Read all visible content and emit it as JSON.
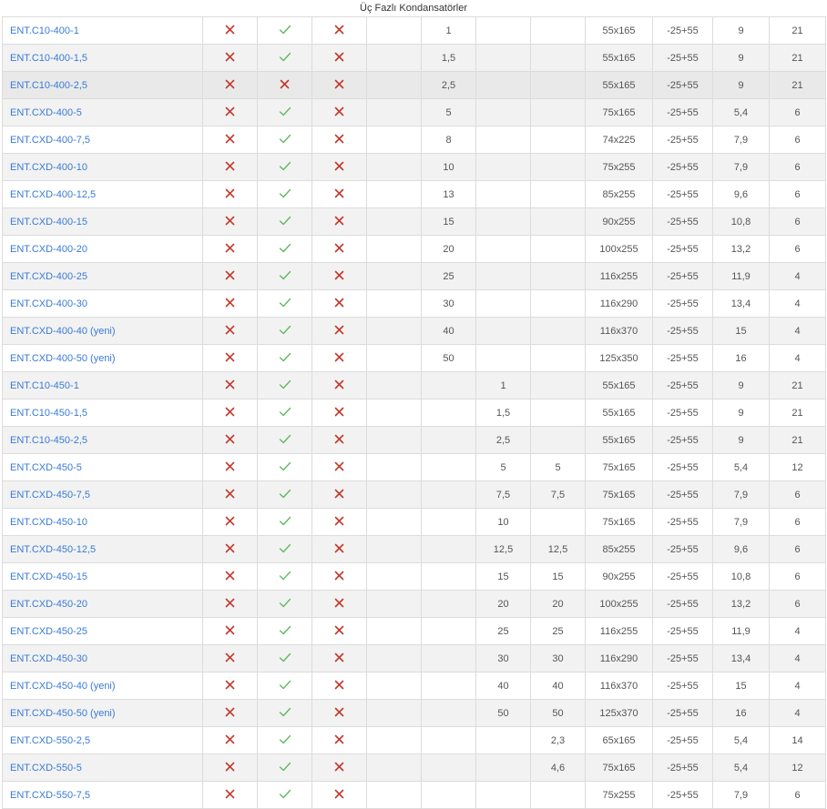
{
  "table": {
    "caption": "Üç Fazlı Kondansatörler",
    "rows": [
      {
        "name": "ENT.C10-400-1",
        "m1": "x",
        "m2": "check",
        "m3": "x",
        "c4": "",
        "c5": "1",
        "c6": "",
        "c7": "",
        "dim": "55x165",
        "temp": "-25+55",
        "c10": "9",
        "c11": "21"
      },
      {
        "name": "ENT.C10-400-1,5",
        "m1": "x",
        "m2": "check",
        "m3": "x",
        "c4": "",
        "c5": "1,5",
        "c6": "",
        "c7": "",
        "dim": "55x165",
        "temp": "-25+55",
        "c10": "9",
        "c11": "21"
      },
      {
        "name": "ENT.C10-400-2,5",
        "m1": "x",
        "m2": "x",
        "m3": "x",
        "c4": "",
        "c5": "2,5",
        "c6": "",
        "c7": "",
        "dim": "55x165",
        "temp": "-25+55",
        "c10": "9",
        "c11": "21"
      },
      {
        "name": "ENT.CXD-400-5",
        "m1": "x",
        "m2": "check",
        "m3": "x",
        "c4": "",
        "c5": "5",
        "c6": "",
        "c7": "",
        "dim": "75x165",
        "temp": "-25+55",
        "c10": "5,4",
        "c11": "6"
      },
      {
        "name": "ENT.CXD-400-7,5",
        "m1": "x",
        "m2": "check",
        "m3": "x",
        "c4": "",
        "c5": "8",
        "c6": "",
        "c7": "",
        "dim": "74x225",
        "temp": "-25+55",
        "c10": "7,9",
        "c11": "6"
      },
      {
        "name": "ENT.CXD-400-10",
        "m1": "x",
        "m2": "check",
        "m3": "x",
        "c4": "",
        "c5": "10",
        "c6": "",
        "c7": "",
        "dim": "75x255",
        "temp": "-25+55",
        "c10": "7,9",
        "c11": "6"
      },
      {
        "name": "ENT.CXD-400-12,5",
        "m1": "x",
        "m2": "check",
        "m3": "x",
        "c4": "",
        "c5": "13",
        "c6": "",
        "c7": "",
        "dim": "85x255",
        "temp": "-25+55",
        "c10": "9,6",
        "c11": "6"
      },
      {
        "name": "ENT.CXD-400-15",
        "m1": "x",
        "m2": "check",
        "m3": "x",
        "c4": "",
        "c5": "15",
        "c6": "",
        "c7": "",
        "dim": "90x255",
        "temp": "-25+55",
        "c10": "10,8",
        "c11": "6"
      },
      {
        "name": "ENT.CXD-400-20",
        "m1": "x",
        "m2": "check",
        "m3": "x",
        "c4": "",
        "c5": "20",
        "c6": "",
        "c7": "",
        "dim": "100x255",
        "temp": "-25+55",
        "c10": "13,2",
        "c11": "6"
      },
      {
        "name": "ENT.CXD-400-25",
        "m1": "x",
        "m2": "check",
        "m3": "x",
        "c4": "",
        "c5": "25",
        "c6": "",
        "c7": "",
        "dim": "116x255",
        "temp": "-25+55",
        "c10": "11,9",
        "c11": "4"
      },
      {
        "name": "ENT.CXD-400-30",
        "m1": "x",
        "m2": "check",
        "m3": "x",
        "c4": "",
        "c5": "30",
        "c6": "",
        "c7": "",
        "dim": "116x290",
        "temp": "-25+55",
        "c10": "13,4",
        "c11": "4"
      },
      {
        "name": "ENT.CXD-400-40 (yeni)",
        "m1": "x",
        "m2": "check",
        "m3": "x",
        "c4": "",
        "c5": "40",
        "c6": "",
        "c7": "",
        "dim": "116x370",
        "temp": "-25+55",
        "c10": "15",
        "c11": "4"
      },
      {
        "name": "ENT.CXD-400-50 (yeni)",
        "m1": "x",
        "m2": "check",
        "m3": "x",
        "c4": "",
        "c5": "50",
        "c6": "",
        "c7": "",
        "dim": "125x350",
        "temp": "-25+55",
        "c10": "16",
        "c11": "4"
      },
      {
        "name": "ENT.C10-450-1",
        "m1": "x",
        "m2": "check",
        "m3": "x",
        "c4": "",
        "c5": "",
        "c6": "1",
        "c7": "",
        "dim": "55x165",
        "temp": "-25+55",
        "c10": "9",
        "c11": "21"
      },
      {
        "name": "ENT.C10-450-1,5",
        "m1": "x",
        "m2": "check",
        "m3": "x",
        "c4": "",
        "c5": "",
        "c6": "1,5",
        "c7": "",
        "dim": "55x165",
        "temp": "-25+55",
        "c10": "9",
        "c11": "21"
      },
      {
        "name": "ENT.C10-450-2,5",
        "m1": "x",
        "m2": "check",
        "m3": "x",
        "c4": "",
        "c5": "",
        "c6": "2,5",
        "c7": "",
        "dim": "55x165",
        "temp": "-25+55",
        "c10": "9",
        "c11": "21"
      },
      {
        "name": "ENT.CXD-450-5",
        "m1": "x",
        "m2": "check",
        "m3": "x",
        "c4": "",
        "c5": "",
        "c6": "5",
        "c7": "5",
        "dim": "75x165",
        "temp": "-25+55",
        "c10": "5,4",
        "c11": "12"
      },
      {
        "name": "ENT.CXD-450-7,5",
        "m1": "x",
        "m2": "check",
        "m3": "x",
        "c4": "",
        "c5": "",
        "c6": "7,5",
        "c7": "7,5",
        "dim": "75x165",
        "temp": "-25+55",
        "c10": "7,9",
        "c11": "6"
      },
      {
        "name": "ENT.CXD-450-10",
        "m1": "x",
        "m2": "check",
        "m3": "x",
        "c4": "",
        "c5": "",
        "c6": "10",
        "c7": "",
        "dim": "75x165",
        "temp": "-25+55",
        "c10": "7,9",
        "c11": "6"
      },
      {
        "name": "ENT.CXD-450-12,5",
        "m1": "x",
        "m2": "check",
        "m3": "x",
        "c4": "",
        "c5": "",
        "c6": "12,5",
        "c7": "12,5",
        "dim": "85x255",
        "temp": "-25+55",
        "c10": "9,6",
        "c11": "6"
      },
      {
        "name": "ENT.CXD-450-15",
        "m1": "x",
        "m2": "check",
        "m3": "x",
        "c4": "",
        "c5": "",
        "c6": "15",
        "c7": "15",
        "dim": "90x255",
        "temp": "-25+55",
        "c10": "10,8",
        "c11": "6"
      },
      {
        "name": "ENT.CXD-450-20",
        "m1": "x",
        "m2": "check",
        "m3": "x",
        "c4": "",
        "c5": "",
        "c6": "20",
        "c7": "20",
        "dim": "100x255",
        "temp": "-25+55",
        "c10": "13,2",
        "c11": "6"
      },
      {
        "name": "ENT.CXD-450-25",
        "m1": "x",
        "m2": "check",
        "m3": "x",
        "c4": "",
        "c5": "",
        "c6": "25",
        "c7": "25",
        "dim": "116x255",
        "temp": "-25+55",
        "c10": "11,9",
        "c11": "4"
      },
      {
        "name": "ENT.CXD-450-30",
        "m1": "x",
        "m2": "check",
        "m3": "x",
        "c4": "",
        "c5": "",
        "c6": "30",
        "c7": "30",
        "dim": "116x290",
        "temp": "-25+55",
        "c10": "13,4",
        "c11": "4"
      },
      {
        "name": "ENT.CXD-450-40 (yeni)",
        "m1": "x",
        "m2": "check",
        "m3": "x",
        "c4": "",
        "c5": "",
        "c6": "40",
        "c7": "40",
        "dim": "116x370",
        "temp": "-25+55",
        "c10": "15",
        "c11": "4"
      },
      {
        "name": "ENT.CXD-450-50 (yeni)",
        "m1": "x",
        "m2": "check",
        "m3": "x",
        "c4": "",
        "c5": "",
        "c6": "50",
        "c7": "50",
        "dim": "125x370",
        "temp": "-25+55",
        "c10": "16",
        "c11": "4"
      },
      {
        "name": "ENT.CXD-550-2,5",
        "m1": "x",
        "m2": "check",
        "m3": "x",
        "c4": "",
        "c5": "",
        "c6": "",
        "c7": "2,3",
        "dim": "65x165",
        "temp": "-25+55",
        "c10": "5,4",
        "c11": "14"
      },
      {
        "name": "ENT.CXD-550-5",
        "m1": "x",
        "m2": "check",
        "m3": "x",
        "c4": "",
        "c5": "",
        "c6": "",
        "c7": "4,6",
        "dim": "75x165",
        "temp": "-25+55",
        "c10": "5,4",
        "c11": "12"
      },
      {
        "name": "ENT.CXD-550-7,5",
        "m1": "x",
        "m2": "check",
        "m3": "x",
        "c4": "",
        "c5": "",
        "c6": "",
        "c7": "",
        "dim": "75x255",
        "temp": "-25+55",
        "c10": "7,9",
        "c11": "6"
      }
    ]
  },
  "colors": {
    "link": "#3a7bd5",
    "cross": "#c0392b",
    "check": "#5cb85c",
    "row_alt": "#f2f2f2",
    "row_highlight": "#e9e9e9",
    "border": "#dcdcdc"
  },
  "icons": {
    "x": "cross-icon",
    "check": "check-icon"
  }
}
